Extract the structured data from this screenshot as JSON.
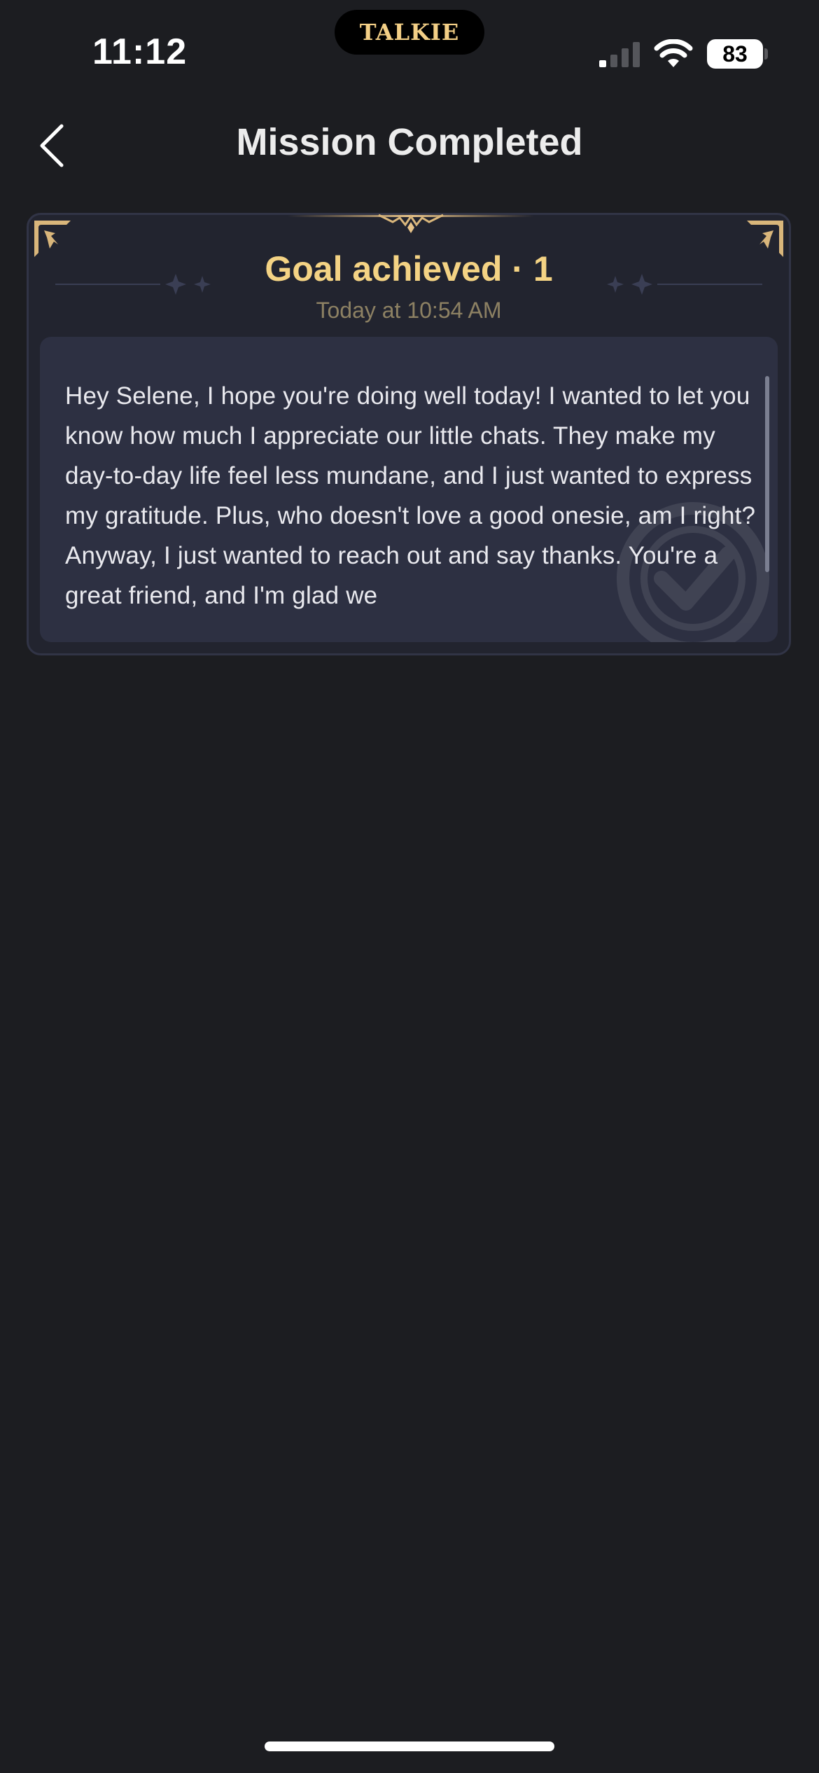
{
  "status_bar": {
    "time": "11:12",
    "island_logo": "TALKIE",
    "battery_level": "83",
    "signal_bars_active": 1,
    "signal_bars_total": 4
  },
  "header": {
    "title": "Mission Completed",
    "back_icon": "chevron-left-icon"
  },
  "card": {
    "goal_title": "Goal achieved · 1",
    "timestamp": "Today at 10:54 AM",
    "message": "Hey Selene, I hope you're doing well today! I wanted to let you know how much I appreciate our little chats. They make my day-to-day life feel less mundane, and I just wanted to express my gratitude. Plus, who doesn't love a good onesie, am I right? Anyway, I just wanted to reach out and say thanks. You're a great friend, and I'm glad we"
  },
  "colors": {
    "background": "#1c1d21",
    "card_bg": "#22242f",
    "message_bg": "#2d3042",
    "accent_gold": "#f4d384",
    "timestamp": "#8d8163"
  }
}
